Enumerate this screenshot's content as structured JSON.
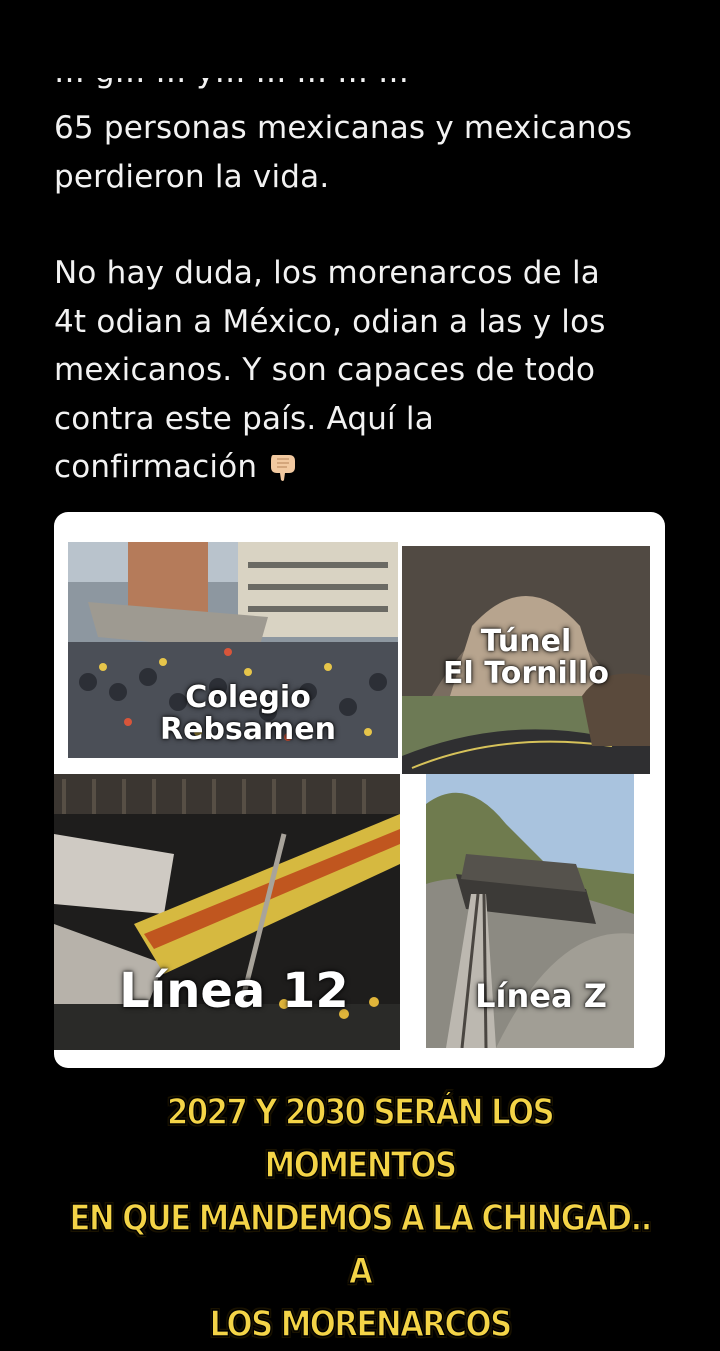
{
  "post": {
    "cut_line": "… g… … y… … … … …",
    "paragraph1_line1": "65 personas mexicanas y mexicanos",
    "paragraph1_line2": "perdieron la vida.",
    "paragraph2_line1": "No hay duda, los morenarcos de la",
    "paragraph2_line2": "4t odian a México, odian a las y los",
    "paragraph2_line3": "mexicanos. Y son capaces  de todo",
    "paragraph2_line4": "contra este país. Aquí la",
    "paragraph2_line5": "confirmación",
    "emoji": "pointing-down-hand-icon"
  },
  "collage": {
    "photo1_caption_line1": "Colegio",
    "photo1_caption_line2": "Rebsamen",
    "photo2_caption_line1": "Túnel",
    "photo2_caption_line2": "El Tornillo",
    "photo3_caption": "Línea 12",
    "photo4_caption": "Línea Z"
  },
  "banner": {
    "line1": "2027 Y 2030 SERÁN LOS MOMENTOS",
    "line2": "EN QUE MANDEMOS A LA CHINGAD.. A",
    "line3": "LOS MORENARCOS"
  },
  "colors": {
    "background": "#000000",
    "text": "#f2f2f2",
    "banner_text": "#f4d447"
  }
}
